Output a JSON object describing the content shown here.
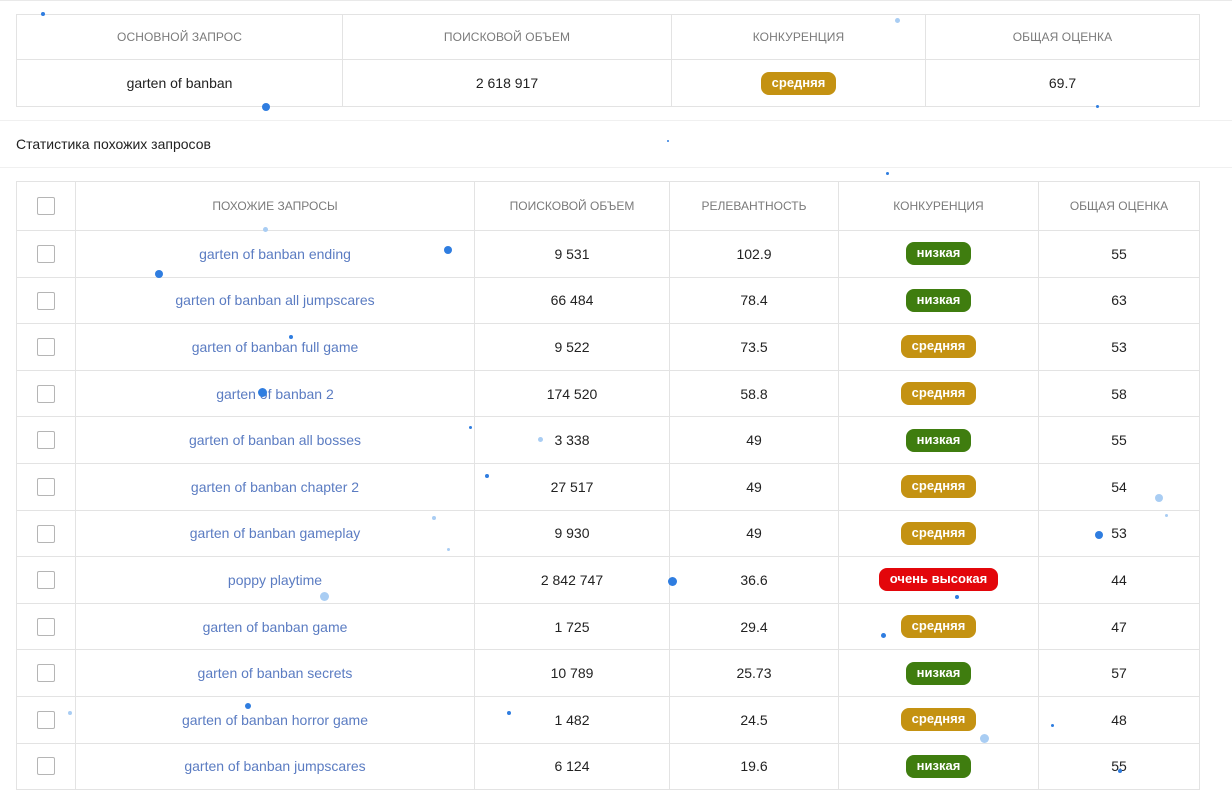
{
  "main_table": {
    "headers": [
      "ОСНОВНОЙ ЗАПРОС",
      "ПОИСКОВОЙ ОБЪЕМ",
      "КОНКУРЕНЦИЯ",
      "ОБЩАЯ ОЦЕНКА"
    ],
    "row": {
      "query": "garten of banban",
      "volume": "2 618 917",
      "competition": "средняя",
      "score": "69.7"
    }
  },
  "section_title": "Статистика похожих запросов",
  "similar_table": {
    "headers": [
      "ПОХОЖИЕ ЗАПРОСЫ",
      "ПОИСКОВОЙ ОБЪЕМ",
      "РЕЛЕВАНТНОСТЬ",
      "КОНКУРЕНЦИЯ",
      "ОБЩАЯ ОЦЕНКА"
    ],
    "rows": [
      {
        "query": "garten of banban ending",
        "volume": "9 531",
        "relevance": "102.9",
        "competition": "низкая",
        "level": "low",
        "score": "55"
      },
      {
        "query": "garten of banban all jumpscares",
        "volume": "66 484",
        "relevance": "78.4",
        "competition": "низкая",
        "level": "low",
        "score": "63"
      },
      {
        "query": "garten of banban full game",
        "volume": "9 522",
        "relevance": "73.5",
        "competition": "средняя",
        "level": "mid",
        "score": "53"
      },
      {
        "query": "garten of banban 2",
        "volume": "174 520",
        "relevance": "58.8",
        "competition": "средняя",
        "level": "mid",
        "score": "58"
      },
      {
        "query": "garten of banban all bosses",
        "volume": "3 338",
        "relevance": "49",
        "competition": "низкая",
        "level": "low",
        "score": "55"
      },
      {
        "query": "garten of banban chapter 2",
        "volume": "27 517",
        "relevance": "49",
        "competition": "средняя",
        "level": "mid",
        "score": "54"
      },
      {
        "query": "garten of banban gameplay",
        "volume": "9 930",
        "relevance": "49",
        "competition": "средняя",
        "level": "mid",
        "score": "53"
      },
      {
        "query": "poppy playtime",
        "volume": "2 842 747",
        "relevance": "36.6",
        "competition": "очень высокая",
        "level": "vhigh",
        "score": "44"
      },
      {
        "query": "garten of banban game",
        "volume": "1 725",
        "relevance": "29.4",
        "competition": "средняя",
        "level": "mid",
        "score": "47"
      },
      {
        "query": "garten of banban secrets",
        "volume": "10 789",
        "relevance": "25.73",
        "competition": "низкая",
        "level": "low",
        "score": "57"
      },
      {
        "query": "garten of banban horror game",
        "volume": "1 482",
        "relevance": "24.5",
        "competition": "средняя",
        "level": "mid",
        "score": "48"
      },
      {
        "query": "garten of banban jumpscares",
        "volume": "6 124",
        "relevance": "19.6",
        "competition": "низкая",
        "level": "low",
        "score": "55"
      }
    ]
  },
  "colors": {
    "link": "#5b7cc2",
    "badge_low": "#3f7d0f",
    "badge_mid": "#c49212",
    "badge_very_high": "#e3060b",
    "dot": "#2f7de0"
  }
}
